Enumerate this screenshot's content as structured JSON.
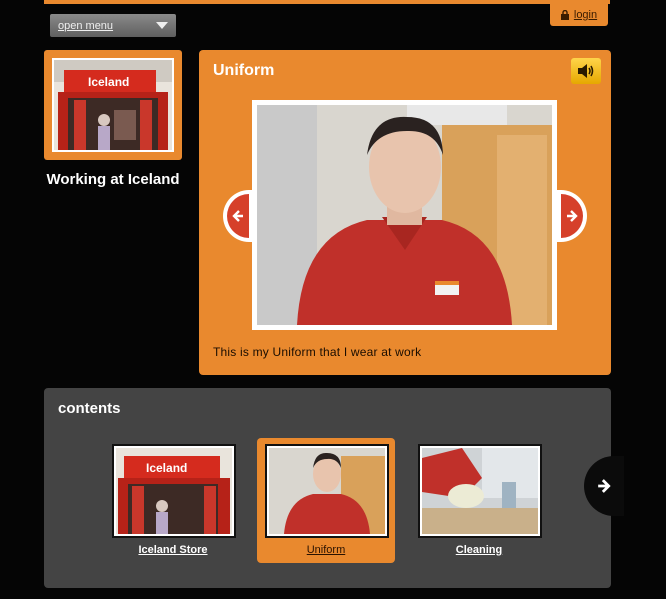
{
  "header": {
    "menu_label": "open menu",
    "login_label": "login"
  },
  "topic": {
    "title": "Working at Iceland",
    "thumb_sign": "Iceland"
  },
  "viewer": {
    "title": "Uniform",
    "caption": "This is my Uniform that I wear at work"
  },
  "contents": {
    "title": "contents",
    "items": [
      {
        "label": "Iceland Store",
        "active": false,
        "sign": "Iceland"
      },
      {
        "label": "Uniform",
        "active": true
      },
      {
        "label": "Cleaning",
        "active": false
      }
    ]
  },
  "icons": {
    "lock": "lock-icon",
    "sound": "speaker-icon",
    "prev": "arrow-left-icon",
    "next": "arrow-right-icon",
    "menu": "chevron-down-icon"
  },
  "colors": {
    "accent": "#e9892e",
    "panel_dark": "#444444",
    "arrow_red": "#d6402a",
    "sound_yellow": "#ffcc33"
  }
}
